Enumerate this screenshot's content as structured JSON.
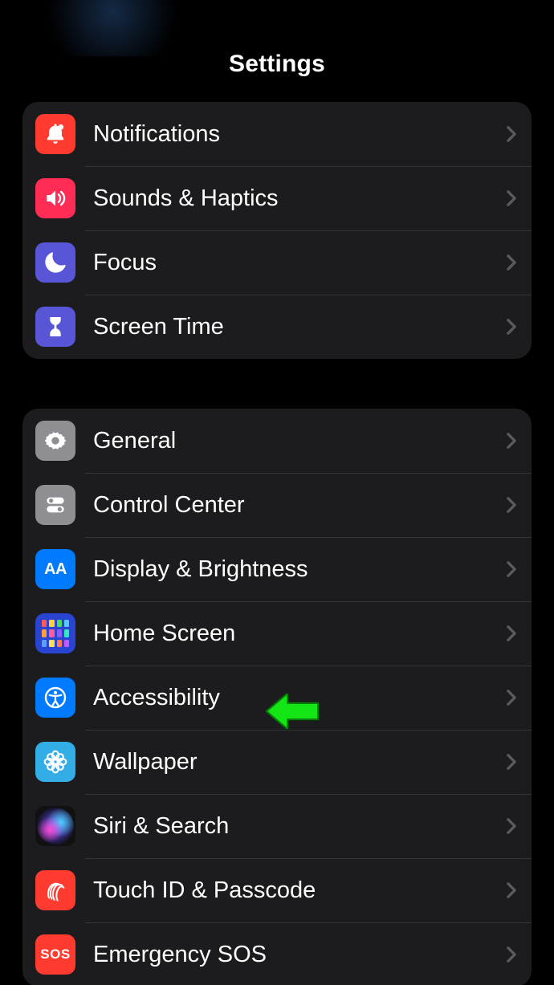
{
  "header": {
    "title": "Settings"
  },
  "groups": [
    {
      "items": [
        {
          "id": "notifications",
          "label": "Notifications",
          "icon": "bell-icon",
          "bg": "bg-red"
        },
        {
          "id": "sounds",
          "label": "Sounds & Haptics",
          "icon": "speaker-icon",
          "bg": "bg-pink"
        },
        {
          "id": "focus",
          "label": "Focus",
          "icon": "moon-icon",
          "bg": "bg-indigo"
        },
        {
          "id": "screen-time",
          "label": "Screen Time",
          "icon": "hourglass-icon",
          "bg": "bg-indigo"
        }
      ]
    },
    {
      "items": [
        {
          "id": "general",
          "label": "General",
          "icon": "gear-icon",
          "bg": "bg-gray"
        },
        {
          "id": "control-center",
          "label": "Control Center",
          "icon": "toggles-icon",
          "bg": "bg-gray"
        },
        {
          "id": "display",
          "label": "Display & Brightness",
          "icon": "aa-icon",
          "bg": "bg-blue"
        },
        {
          "id": "home-screen",
          "label": "Home Screen",
          "icon": "home-grid-icon",
          "bg": "bg-blue"
        },
        {
          "id": "accessibility",
          "label": "Accessibility",
          "icon": "accessibility-icon",
          "bg": "bg-blue"
        },
        {
          "id": "wallpaper",
          "label": "Wallpaper",
          "icon": "flower-icon",
          "bg": "bg-cyan"
        },
        {
          "id": "siri",
          "label": "Siri & Search",
          "icon": "siri-icon",
          "bg": "bg-black"
        },
        {
          "id": "touch-id",
          "label": "Touch ID & Passcode",
          "icon": "fingerprint-icon",
          "bg": "bg-red"
        },
        {
          "id": "emergency-sos",
          "label": "Emergency SOS",
          "icon": "sos-icon",
          "bg": "bg-sosred"
        }
      ]
    }
  ],
  "annotation": {
    "target": "accessibility",
    "color": "#14e514"
  }
}
